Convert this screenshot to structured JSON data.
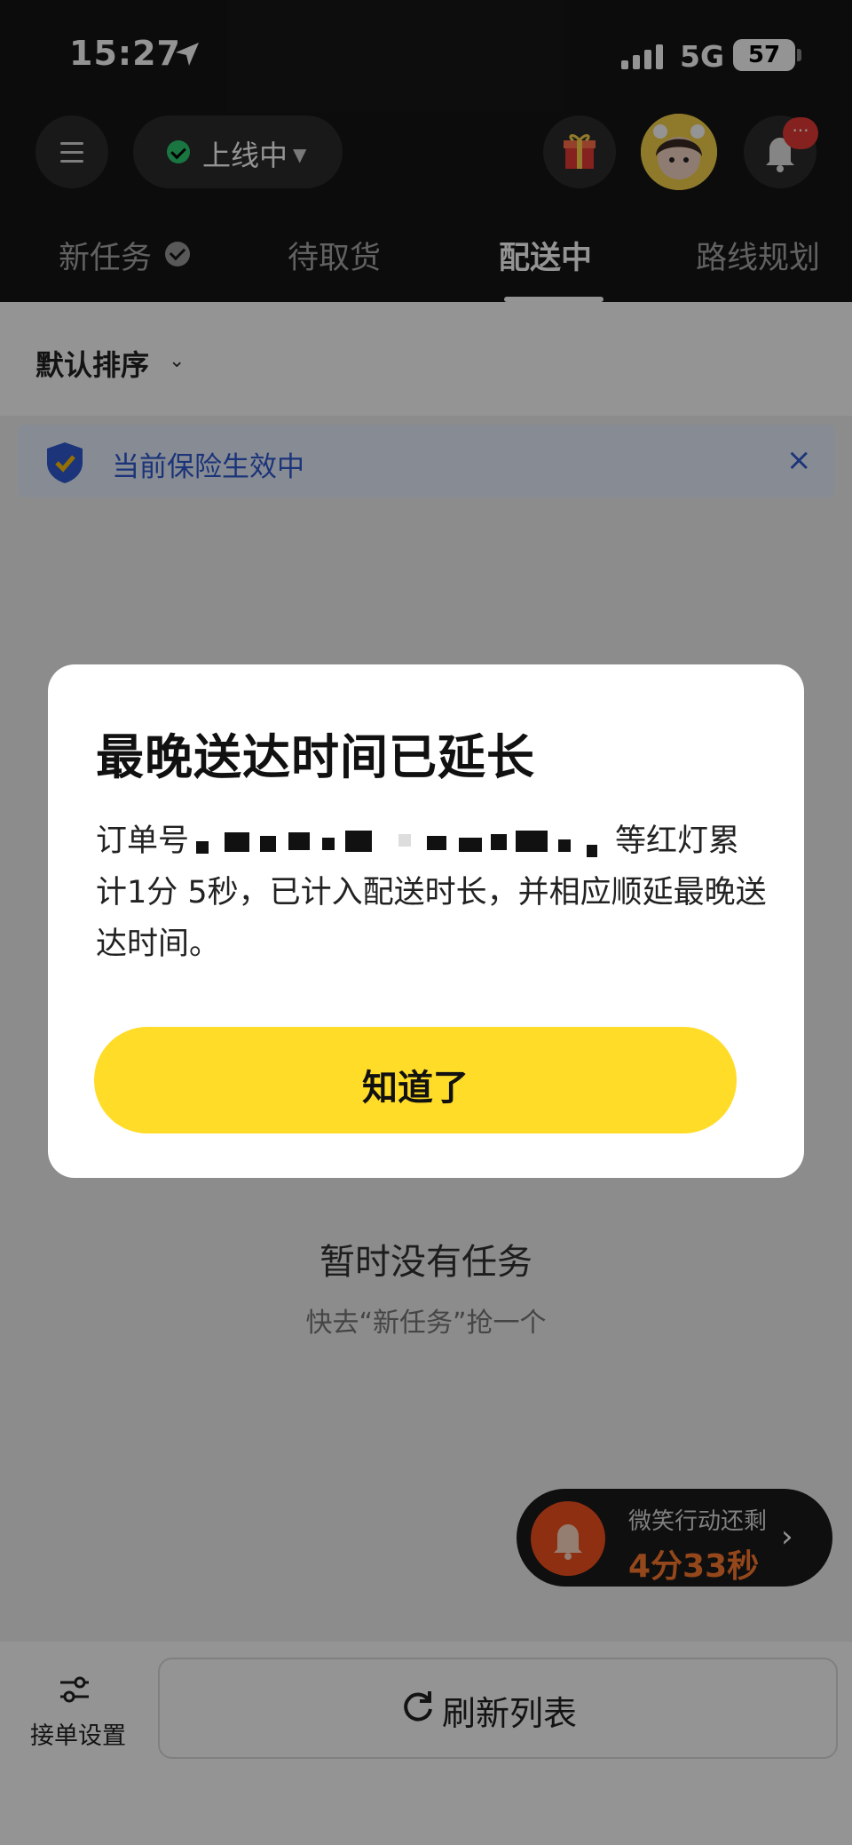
{
  "status_bar": {
    "time": "15:27",
    "network": "5G",
    "battery": "57"
  },
  "header": {
    "status_pill": "上线中",
    "tabs": [
      {
        "label": "新任务"
      },
      {
        "label": "待取货"
      },
      {
        "label": "配送中"
      },
      {
        "label": "路线规划"
      }
    ],
    "active_tab": "配送中",
    "notification_badge": "···"
  },
  "sort": {
    "label": "默认排序"
  },
  "banner": {
    "text": "当前保险生效中",
    "close": "×"
  },
  "empty_state": {
    "title": "暂时没有任务",
    "subtitle": "快去“新任务”抢一个"
  },
  "smile_action": {
    "label": "微笑行动还剩",
    "countdown": "4分33秒",
    "arrow": "›"
  },
  "bottom": {
    "settings_label": "接单设置",
    "refresh_label": "刷新列表"
  },
  "dialog": {
    "title": "最晚送达时间已延长",
    "body_prefix": "订单号",
    "body_suffix": "等红灯累计1分 5秒，已计入配送时长，并相应顺延最晚送达时间。",
    "confirm_label": "知道了"
  },
  "colors": {
    "header_bg": "#161616",
    "accent_yellow": "#ffdc28",
    "online_green": "#2ecc71",
    "banner_blue": "#2f5bd3",
    "countdown_orange": "#ff7a30"
  }
}
